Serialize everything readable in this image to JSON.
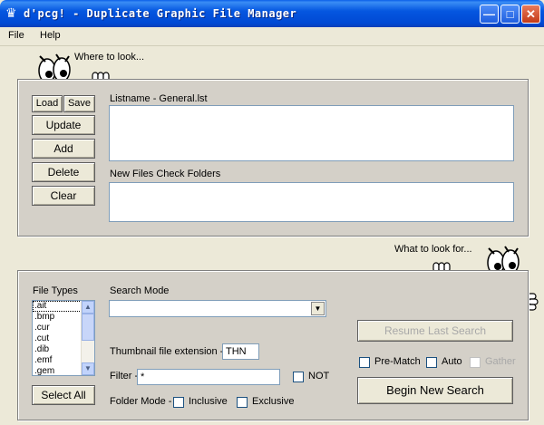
{
  "window": {
    "title": "d'pcg! - Duplicate Graphic File Manager"
  },
  "menu": {
    "file": "File",
    "help": "Help"
  },
  "where": {
    "heading": "Where to look...",
    "load": "Load",
    "save": "Save",
    "update": "Update",
    "add": "Add",
    "delete": "Delete",
    "clear": "Clear",
    "listname_label": "Listname - General.lst",
    "new_files_label": "New Files Check Folders"
  },
  "what": {
    "heading": "What to look for...",
    "file_types_label": "File Types",
    "file_types": [
      ".ait",
      ".bmp",
      ".cur",
      ".cut",
      ".dib",
      ".emf",
      ".gem"
    ],
    "select_all": "Select All",
    "search_mode_label": "Search Mode",
    "search_mode_value": "",
    "thumb_ext_label": "Thumbnail file extension -",
    "thumb_ext_value": "THN",
    "filter_label": "Filter -",
    "filter_value": "*",
    "not_label": "NOT",
    "folder_mode_label": "Folder Mode -",
    "inclusive_label": "Inclusive",
    "exclusive_label": "Exclusive",
    "resume_label": "Resume Last Search",
    "prematch_label": "Pre-Match",
    "auto_label": "Auto",
    "gather_label": "Gather",
    "begin_label": "Begin New Search"
  }
}
